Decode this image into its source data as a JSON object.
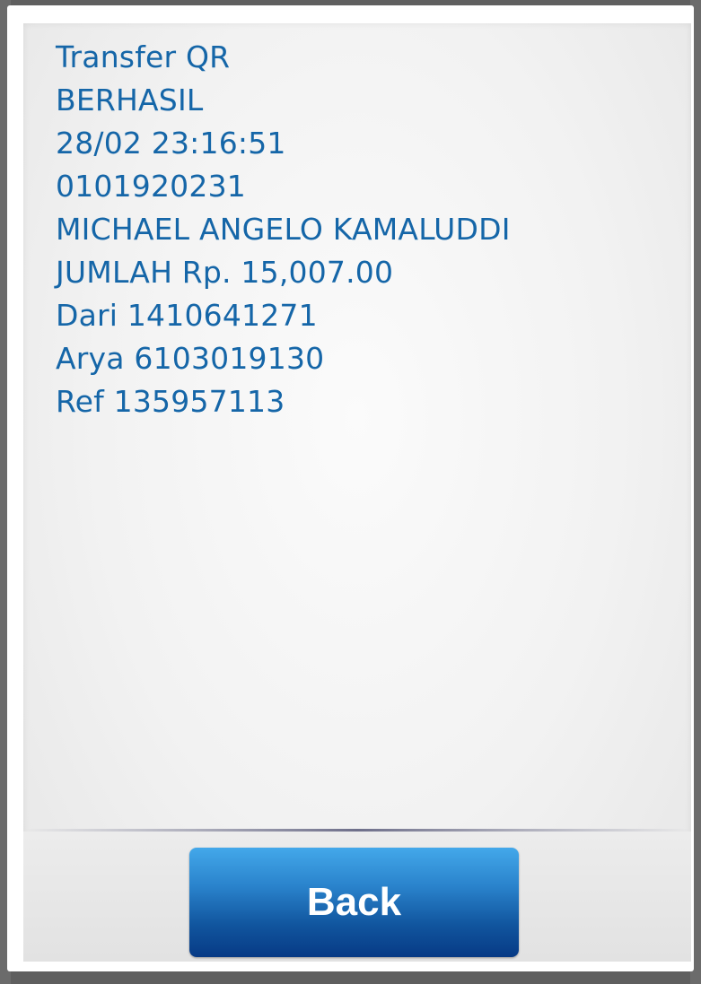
{
  "message_lines": [
    "Transfer QR",
    "BERHASIL",
    "28/02 23:16:51",
    "0101920231",
    "MICHAEL ANGELO KAMALUDDI",
    "JUMLAH Rp. 15,007.00",
    "Dari 1410641271",
    "Arya 6103019130",
    "Ref 135957113"
  ],
  "footer": {
    "back_label": "Back"
  },
  "colors": {
    "message_text": "#1566a8",
    "button_top": "#43a8ea",
    "button_bottom": "#073a85",
    "overlay": "#5f5f5f"
  }
}
